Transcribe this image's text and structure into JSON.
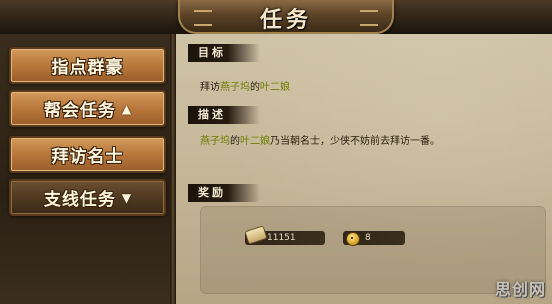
{
  "window": {
    "title": "任务"
  },
  "sidebar": {
    "items": [
      {
        "label": "指点群豪",
        "arrow": ""
      },
      {
        "label": "帮会任务",
        "arrow": "▲"
      },
      {
        "label": "拜访名士",
        "arrow": ""
      },
      {
        "label": "支线任务",
        "arrow": "▼"
      }
    ]
  },
  "quest": {
    "objective": {
      "heading": "目标",
      "prefix": "拜访",
      "place": "燕子坞",
      "of": "的",
      "npc": "叶二娘"
    },
    "description": {
      "heading": "描述",
      "place": "燕子坞",
      "of": "的",
      "npc": "叶二娘",
      "text": "乃当朝名士，少侠不妨前去拜访一番。"
    },
    "rewards": {
      "heading": "奖励",
      "items": [
        {
          "icon": "scroll-icon",
          "value": "11151"
        },
        {
          "icon": "coin-icon",
          "value": "8"
        }
      ]
    }
  },
  "watermark": "思创网",
  "colors": {
    "highlight": "#6d7d00",
    "button": "#b8773b",
    "parchment": "#c4b596"
  }
}
